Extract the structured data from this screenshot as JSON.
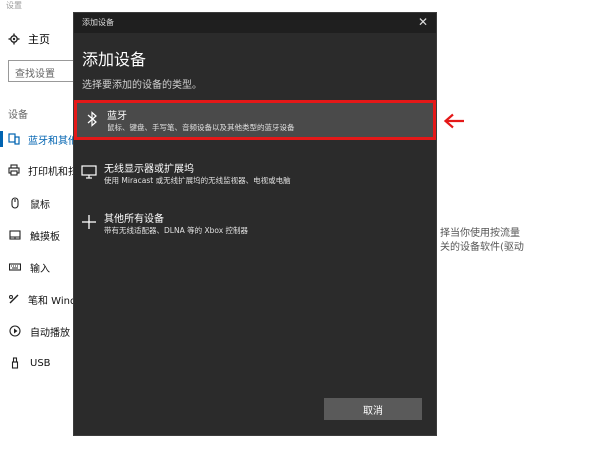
{
  "background": {
    "window_title": "设置",
    "home_label": "主页",
    "search_placeholder": "查找设置",
    "section_label": "设备",
    "nav_items": [
      {
        "label": "蓝牙和其他设备",
        "icon": "bluetooth-devices-icon"
      },
      {
        "label": "打印机和扫描仪",
        "icon": "printer-icon"
      },
      {
        "label": "鼠标",
        "icon": "mouse-icon"
      },
      {
        "label": "触摸板",
        "icon": "touchpad-icon"
      },
      {
        "label": "输入",
        "icon": "keyboard-icon"
      },
      {
        "label": "笔和 Windows Ink",
        "icon": "pen-icon"
      },
      {
        "label": "自动播放",
        "icon": "autoplay-icon"
      },
      {
        "label": "USB",
        "icon": "usb-icon"
      }
    ],
    "right_text_line1": "择当你使用按流量",
    "right_text_line2": "关的设备软件(驱动"
  },
  "dialog": {
    "title": "添加设备",
    "heading": "添加设备",
    "subtitle": "选择要添加的设备的类型。",
    "options": [
      {
        "title": "蓝牙",
        "desc": "鼠标、键盘、手写笔、音频设备以及其他类型的蓝牙设备",
        "icon": "bluetooth-icon"
      },
      {
        "title": "无线显示器或扩展坞",
        "desc": "使用 Miracast 或无线扩展坞的无线监视器、电视或电脑",
        "icon": "monitor-icon"
      },
      {
        "title": "其他所有设备",
        "desc": "带有无线适配器、DLNA 等的 Xbox 控制器",
        "icon": "plus-icon"
      }
    ],
    "cancel_label": "取消"
  },
  "colors": {
    "dialog_bg": "#2b2b2b",
    "highlight_border": "#e41818",
    "accent": "#0063b1"
  }
}
